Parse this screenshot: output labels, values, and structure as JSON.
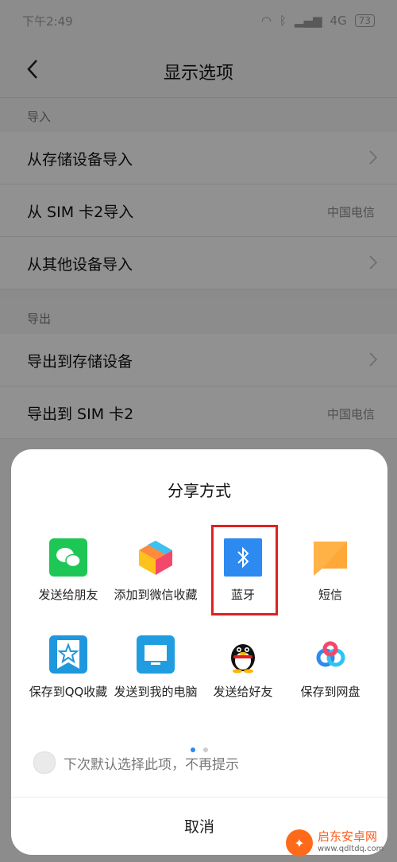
{
  "status": {
    "time": "下午2:49",
    "network": "4G",
    "battery": "73"
  },
  "header": {
    "title": "显示选项"
  },
  "import": {
    "label": "导入",
    "items": [
      {
        "label": "从存储设备导入",
        "value": ""
      },
      {
        "label": "从 SIM 卡2导入",
        "value": "中国电信"
      },
      {
        "label": "从其他设备导入",
        "value": ""
      }
    ]
  },
  "export": {
    "label": "导出",
    "items": [
      {
        "label": "导出到存储设备",
        "value": ""
      },
      {
        "label": "导出到 SIM 卡2",
        "value": "中国电信"
      }
    ]
  },
  "share_sheet": {
    "title": "分享方式",
    "options": [
      {
        "label": "发送给朋友",
        "icon": "wechat-icon"
      },
      {
        "label": "添加到微信收藏",
        "icon": "wechat-favorites-icon"
      },
      {
        "label": "蓝牙",
        "icon": "bluetooth-icon"
      },
      {
        "label": "短信",
        "icon": "sms-icon"
      },
      {
        "label": "保存到QQ收藏",
        "icon": "qq-favorites-icon"
      },
      {
        "label": "发送到我的电脑",
        "icon": "computer-icon"
      },
      {
        "label": "发送给好友",
        "icon": "qq-icon"
      },
      {
        "label": "保存到网盘",
        "icon": "cloud-drive-icon"
      }
    ],
    "remember_label": "下次默认选择此项，不再提示",
    "cancel_label": "取消"
  },
  "watermark": {
    "name": "启东安卓网",
    "url": "www.qdltdq.com"
  },
  "colors": {
    "accent": "#2c8af0",
    "highlight": "#e02020",
    "wechat": "#1ec655"
  }
}
